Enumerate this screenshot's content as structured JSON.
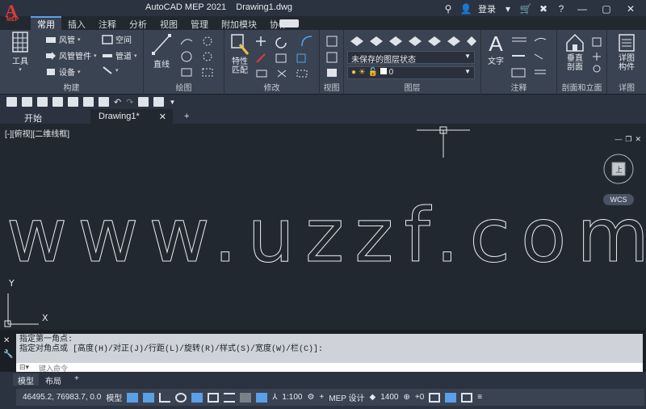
{
  "app": {
    "logo_letter": "A",
    "logo_sub": "MEP",
    "title": "AutoCAD MEP 2021    Drawing1.dwg",
    "login_label": "登录"
  },
  "ribbon_tabs": [
    "常用",
    "插入",
    "注释",
    "分析",
    "视图",
    "管理",
    "附加模块",
    "协作"
  ],
  "ribbon": {
    "tools_label": "工具",
    "construct": {
      "title": "构建",
      "items": [
        "风管",
        "风管管件",
        "设备",
        "空间",
        "管道"
      ]
    },
    "draw": {
      "title": "绘图",
      "line_label": "直线"
    },
    "modify": {
      "title": "修改",
      "match_label": "特性\n匹配"
    },
    "view": {
      "title": "视图"
    },
    "layers": {
      "title": "图层",
      "layer_state": "未保存的图层状态",
      "current_layer": "0"
    },
    "annotation": {
      "title": "注释",
      "text_label": "文字"
    },
    "section": {
      "title": "剖面和立面",
      "vertical_label": "垂直\n剖面"
    },
    "detail": {
      "title": "详图",
      "component_label": "详图\n构件"
    }
  },
  "doc_tabs": [
    "开始",
    "Drawing1*"
  ],
  "canvas": {
    "view_label": "[-][俯视][二维线框]",
    "watermark": "www.uzzf.com",
    "wcs_label": "WCS",
    "axis_x": "X",
    "axis_y": "Y"
  },
  "command": {
    "line1": "指定第一角点:",
    "line2": "指定对角点或 [高度(H)/对正(J)/行距(L)/旋转(R)/样式(S)/宽度(W)/栏(C)]:",
    "placeholder": "键入命令"
  },
  "layout_tabs": [
    "模型",
    "布局"
  ],
  "status": {
    "coords": "46495.2, 76983.7, 0.0",
    "model_label": "模型",
    "scale": "1:100",
    "design_label": "MEP 设计",
    "number": "1400",
    "plus_zero": "+0"
  },
  "colors": {
    "canvas_bg": "#212830",
    "ribbon_bg": "#3a4352",
    "accent": "#5aa0e6",
    "logo_red": "#e43a3a"
  }
}
